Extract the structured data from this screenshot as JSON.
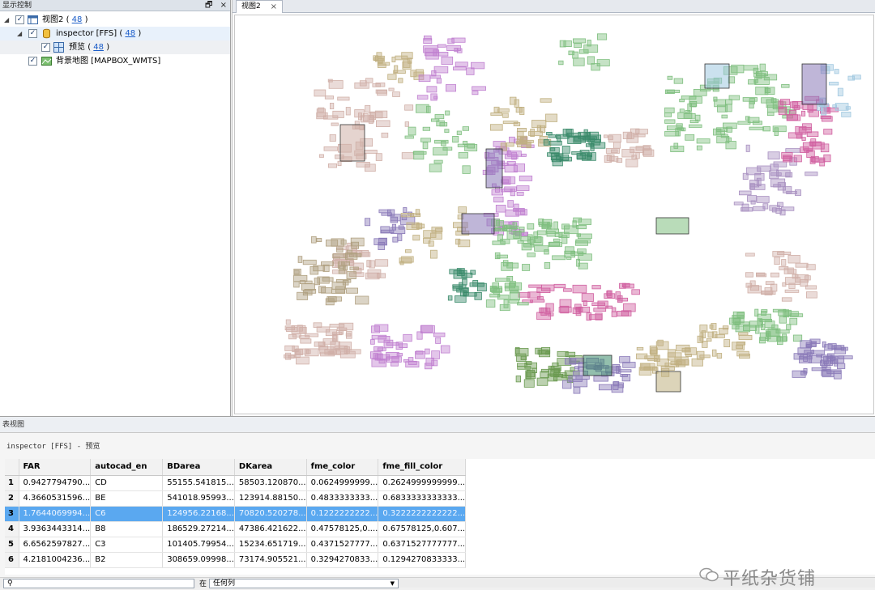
{
  "left_panel": {
    "title": "显示控制",
    "restore_btn": "🗗",
    "close_btn": "×",
    "tree": [
      {
        "label": "视图2",
        "count": "48",
        "checked": "✓"
      },
      {
        "label": "inspector [FFS]",
        "count": "48",
        "checked": "✓"
      },
      {
        "label": "预览",
        "count": "48",
        "checked": "✓"
      },
      {
        "label": "背景地图 [MAPBOX_WMTS]",
        "checked": "✓"
      }
    ],
    "count_open": "(",
    "count_close": ")"
  },
  "view": {
    "tab_label": "视图2",
    "tab_close": "×"
  },
  "table_view": {
    "title": "表视图",
    "subtitle": "inspector [FFS] - 预览",
    "columns": [
      "FAR",
      "autocad_en",
      "BDarea",
      "DKarea",
      "fme_color",
      "fme_fill_color"
    ],
    "rows": [
      [
        "1",
        "0.9427794790...",
        "CD",
        "55155.541815...",
        "58503.120870...",
        "0.0624999999...",
        "0.2624999999999..."
      ],
      [
        "2",
        "4.3660531596...",
        "BE",
        "541018.95993...",
        "123914.88150...",
        "0.4833333333...",
        "0.6833333333333..."
      ],
      [
        "3",
        "1.7644069994...",
        "C6",
        "124956.22168...",
        "70820.520278...",
        "0.1222222222...",
        "0.3222222222222..."
      ],
      [
        "4",
        "3.9363443314...",
        "B8",
        "186529.27214...",
        "47386.421622...",
        "0.47578125,0....",
        "0.67578125,0.607..."
      ],
      [
        "5",
        "6.6562597827...",
        "C3",
        "101405.79954...",
        "15234.651719...",
        "0.4371527777...",
        "0.6371527777777..."
      ],
      [
        "6",
        "4.2181004236...",
        "B2",
        "308659.09998...",
        "73174.905521...",
        "0.3294270833...",
        "0.1294270833333..."
      ]
    ],
    "selected_row": 2,
    "search_placeholder": "",
    "filter_label": "在",
    "filter_value": "任何列"
  },
  "watermark": "平纸杂货铺",
  "colors": {
    "selection": "#5aa8f0",
    "link": "#1a5cc8",
    "parcel_palette": [
      "#7fbf7f",
      "#c080d0",
      "#d0b0a8",
      "#8a7ab8",
      "#3a8a6a",
      "#c0b080",
      "#a0c8e0",
      "#d060a0",
      "#6a9a50",
      "#a890c0",
      "#b0a080",
      "#50a0a0"
    ]
  }
}
